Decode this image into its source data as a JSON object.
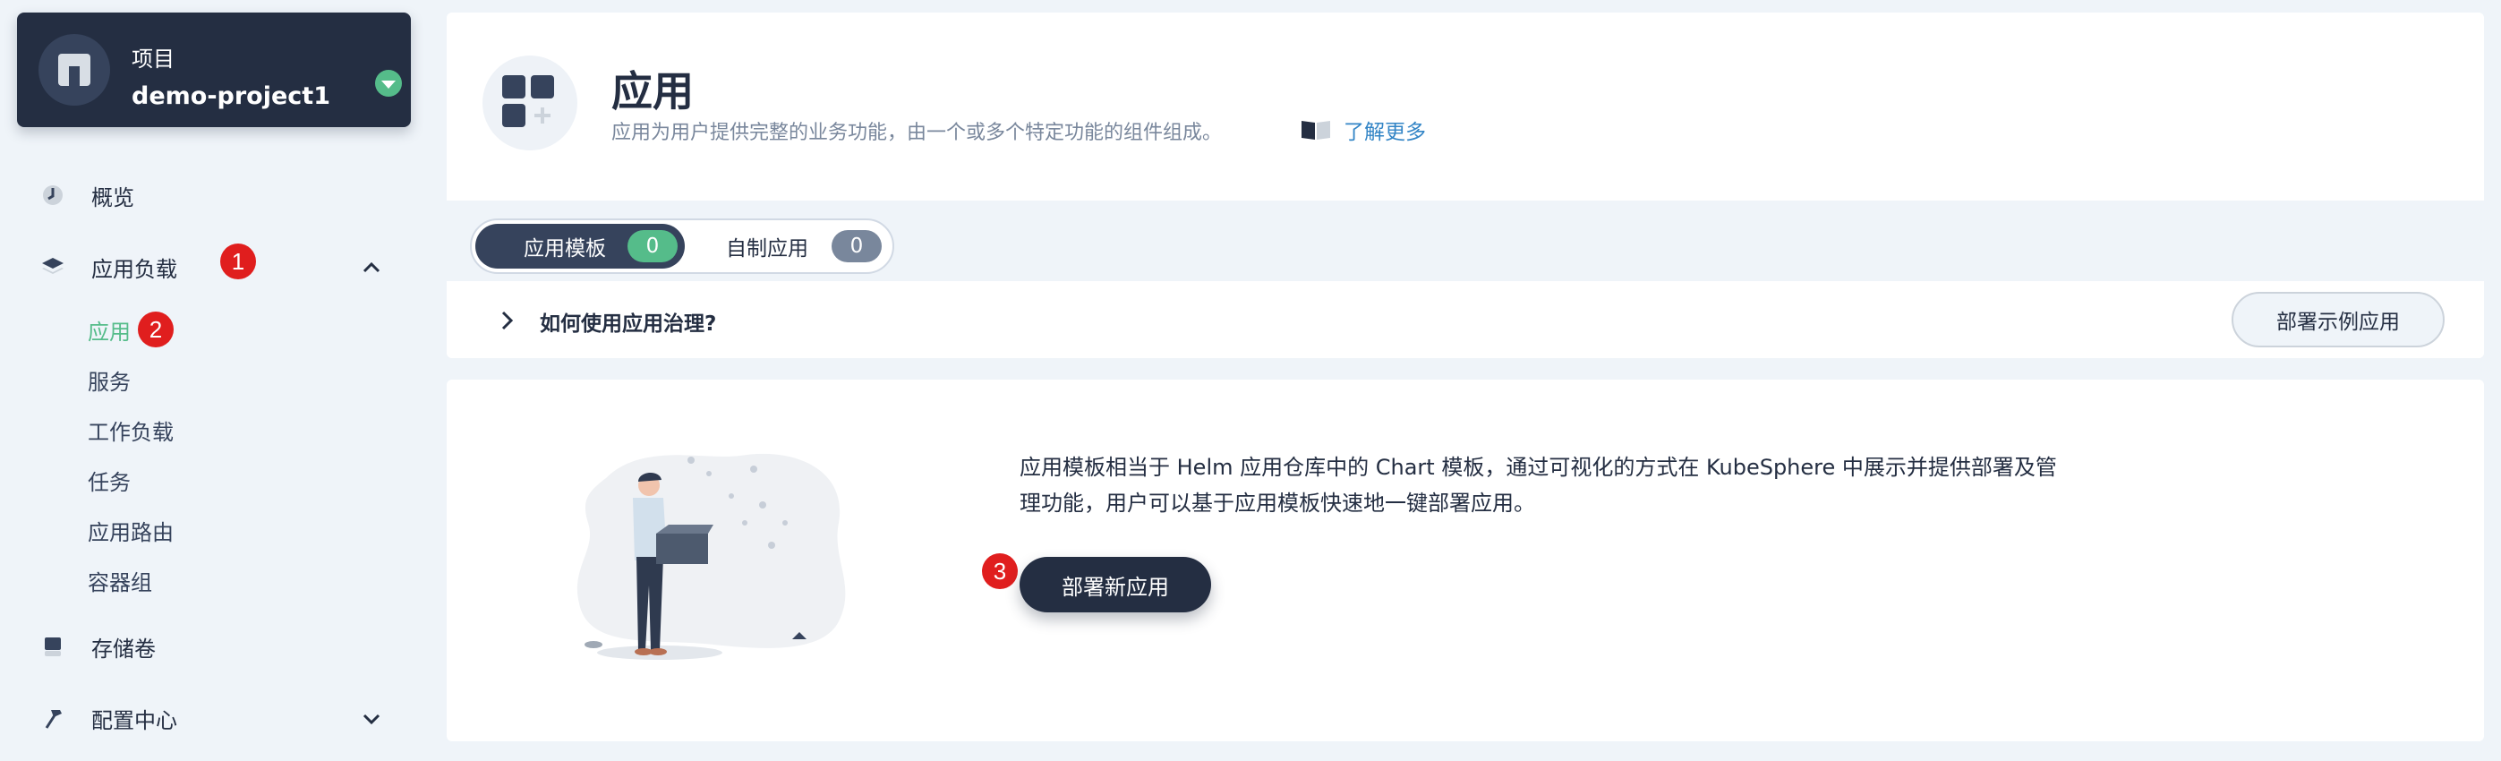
{
  "sidebar": {
    "project": {
      "label": "项目",
      "name": "demo-project1"
    },
    "items": [
      {
        "label": "概览"
      },
      {
        "label": "应用负载"
      },
      {
        "label": "存储卷"
      },
      {
        "label": "配置中心"
      }
    ],
    "sub_items": [
      {
        "label": "应用"
      },
      {
        "label": "服务"
      },
      {
        "label": "工作负载"
      },
      {
        "label": "任务"
      },
      {
        "label": "应用路由"
      },
      {
        "label": "容器组"
      }
    ],
    "badges": [
      "1",
      "2",
      "3"
    ]
  },
  "header": {
    "title": "应用",
    "description": "应用为用户提供完整的业务功能，由一个或多个特定功能的组件组成。",
    "learn_more": "了解更多"
  },
  "tabs": [
    {
      "label": "应用模板",
      "count": "0"
    },
    {
      "label": "自制应用",
      "count": "0"
    }
  ],
  "howto": {
    "question": "如何使用应用治理?",
    "deploy_sample_button": "部署示例应用"
  },
  "empty_state": {
    "description": "应用模板相当于 Helm 应用仓库中的 Chart 模板，通过可视化的方式在 KubeSphere 中展示并提供部署及管理功能，用户可以基于应用模板快速地一键部署应用。",
    "deploy_button": "部署新应用"
  },
  "colors": {
    "dark": "#242e42",
    "accent_green": "#55bc8a",
    "link_blue": "#3385c6",
    "badge_red": "#e01e1e",
    "background": "#eff4f9"
  }
}
